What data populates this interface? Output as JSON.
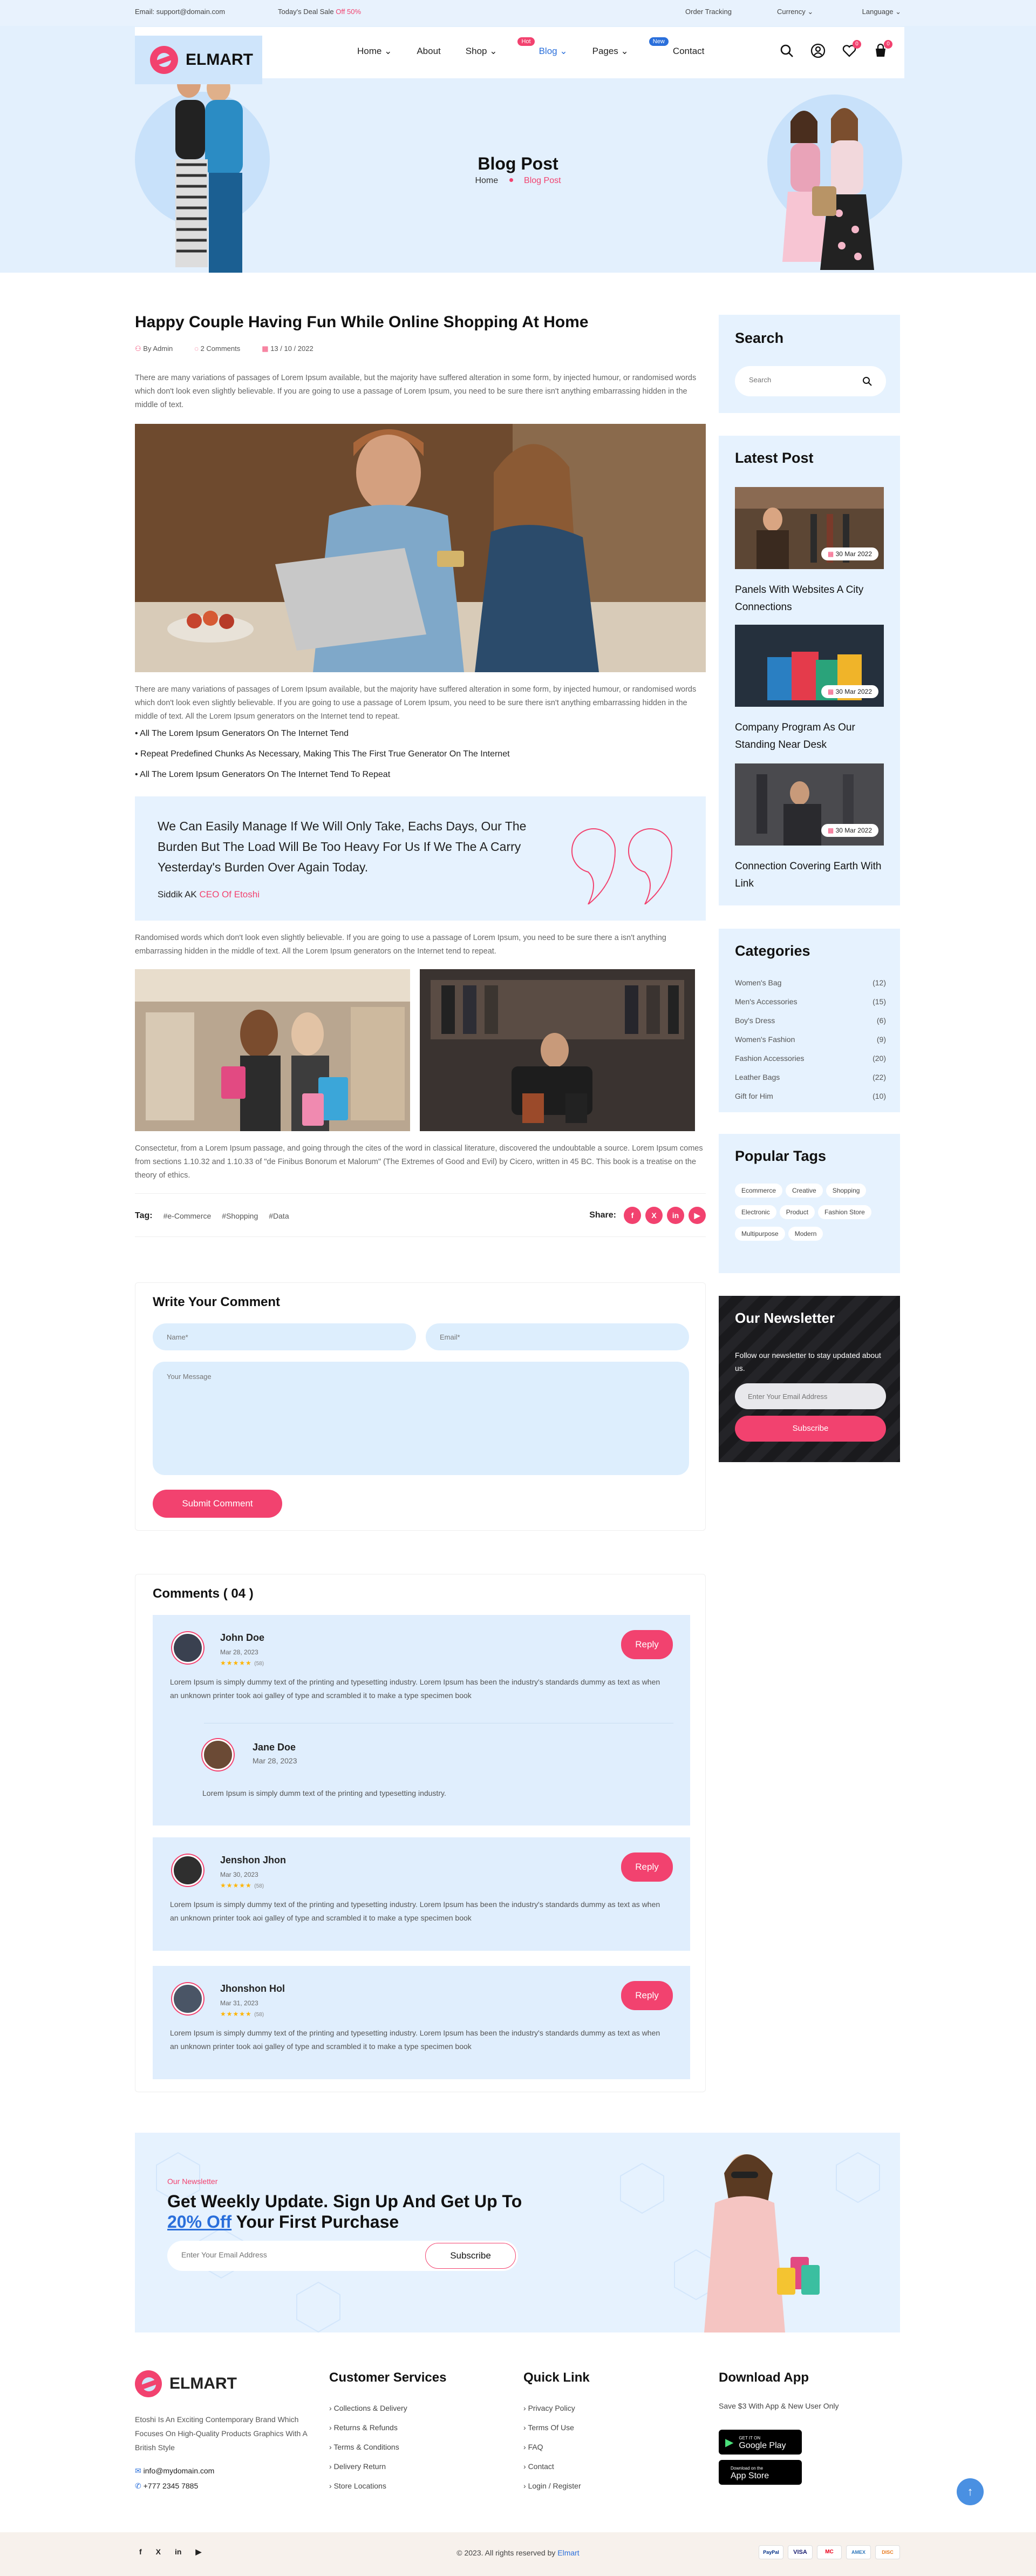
{
  "topbar": {
    "email": "Email: support@domain.com",
    "deal": "Today's Deal Sale",
    "deal_pct": "Off 50%",
    "order": "Order Tracking",
    "currency": "Currency",
    "language": "Language"
  },
  "header": {
    "logo": "ELMART",
    "nav": [
      "Home",
      "About",
      "Shop",
      "Blog",
      "Pages",
      "Contact"
    ],
    "badge_hot": "Hot",
    "badge_new": "New",
    "cart_count": "0",
    "wish_count": "0"
  },
  "hero": {
    "title": "Blog Post",
    "crumb_home": "Home",
    "crumb_current": "Blog Post"
  },
  "post": {
    "title": "Happy Couple Having Fun While Online Shopping At Home",
    "author": "By Admin",
    "comments": "2 Comments",
    "date": "13 / 10 / 2022",
    "p1": "There are many variations of passages of Lorem Ipsum available, but the majority have suffered alteration in some form, by injected humour, or randomised words which don't look even slightly believable. If you are going to use a passage of Lorem Ipsum, you need to be sure there isn't anything embarrassing hidden in the middle of text.",
    "p2": "There are many variations of passages of Lorem Ipsum available, but the majority have suffered alteration in some form, by injected humour, or randomised words which don't look even slightly believable. If you are going to use a passage of Lorem Ipsum, you need to be sure there isn't anything embarrassing hidden in the middle of text. All the Lorem Ipsum generators on the Internet tend to repeat.",
    "bullets": [
      "All The Lorem Ipsum Generators On The Internet Tend",
      "Repeat Predefined Chunks As Necessary, Making This The First True Generator On The Internet",
      "All The Lorem Ipsum Generators On The Internet Tend To Repeat"
    ],
    "quote": "We Can Easily Manage If We Will Only Take, Eachs Days, Our The Burden But The Load Will Be Too Heavy For Us If We The A Carry Yesterday's Burden Over Again Today.",
    "quote_author": "Siddik AK",
    "quote_role": "CEO Of Etoshi",
    "p3": "Randomised words which don't look even slightly believable. If you are going to use a passage of Lorem Ipsum, you need to be sure there a isn't anything embarrassing hidden in the middle of text. All the Lorem Ipsum generators on the Internet tend to repeat.",
    "p4": "Consectetur, from a Lorem Ipsum passage, and going through the cites of the word in classical literature, discovered the undoubtable a source. Lorem Ipsum comes from sections 1.10.32 and 1.10.33 of \"de Finibus Bonorum et Malorum\" (The Extremes of Good and Evil) by Cicero, written in 45 BC. This book is a treatise on the theory of ethics.",
    "tag_label": "Tag:",
    "tags": [
      "#e-Commerce",
      "#Shopping",
      "#Data"
    ],
    "share_label": "Share:"
  },
  "comment_form": {
    "title": "Write Your Comment",
    "name_ph": "Name*",
    "email_ph": "Email*",
    "message_ph": "Your Message",
    "submit": "Submit Comment"
  },
  "comments": {
    "title": "Comments ( 04 )",
    "reply": "Reply",
    "items": [
      {
        "name": "John Doe",
        "date": "Mar 28, 2023",
        "rating": "(58)",
        "text": "Lorem Ipsum is simply dummy text of the printing and typesetting industry. Lorem Ipsum has been the industry's standards dummy as text as when an unknown printer took aoi galley of type and scrambled it to make a type specimen book"
      },
      {
        "name": "Jane Doe",
        "date": "Mar 28, 2023",
        "text": "Lorem Ipsum is simply dumm text of the printing and typesetting industry."
      },
      {
        "name": "Jenshon Jhon",
        "date": "Mar 30, 2023",
        "rating": "(58)",
        "text": "Lorem Ipsum is simply dummy text of the printing and typesetting industry. Lorem Ipsum has been the industry's standards dummy as text as when an unknown printer took aoi galley of type and scrambled it to make a type specimen book"
      },
      {
        "name": "Jhonshon Hol",
        "date": "Mar 31, 2023",
        "rating": "(58)",
        "text": "Lorem Ipsum is simply dummy text of the printing and typesetting industry. Lorem Ipsum has been the industry's standards dummy as text as when an unknown printer took aoi galley of type and scrambled it to make a type specimen book"
      }
    ]
  },
  "sidebar": {
    "search_title": "Search",
    "search_ph": "Search",
    "latest_title": "Latest Post",
    "latest": [
      {
        "date": "30 Mar 2022",
        "title": "Panels With Websites A City Connections"
      },
      {
        "date": "30 Mar 2022",
        "title": "Company Program As Our Standing Near Desk"
      },
      {
        "date": "30 Mar 2022",
        "title": "Connection Covering Earth With Link"
      }
    ],
    "cat_title": "Categories",
    "cats": [
      {
        "n": "Women's Bag",
        "c": "(12)"
      },
      {
        "n": "Men's Accessories",
        "c": "(15)"
      },
      {
        "n": "Boy's Dress",
        "c": "(6)"
      },
      {
        "n": "Women's Fashion",
        "c": "(9)"
      },
      {
        "n": "Fashion Accessories",
        "c": "(20)"
      },
      {
        "n": "Leather Bags",
        "c": "(22)"
      },
      {
        "n": "Gift for Him",
        "c": "(10)"
      }
    ],
    "tags_title": "Popular Tags",
    "tags": [
      "Ecommerce",
      "Creative",
      "Shopping",
      "Electronic",
      "Product",
      "Fashion Store",
      "Multipurpose",
      "Modern"
    ],
    "news_title": "Our Newsletter",
    "news_sub": "Follow our newsletter to stay updated about us.",
    "news_ph": "Enter Your Email Address",
    "news_btn": "Subscribe"
  },
  "banner": {
    "eyebrow": "Our Newsletter",
    "title1": "Get Weekly Update. Sign Up And Get Up To",
    "title_pct": "20% Off",
    "title2": "Your First Purchase",
    "ph": "Enter Your Email Address",
    "btn": "Subscribe"
  },
  "footer": {
    "logo": "ELMART",
    "about": "Etoshi Is An Exciting Contemporary Brand Which Focuses On High-Quality Products Graphics With A British Style",
    "email": "info@mydomain.com",
    "phone": "+777 2345 7885",
    "cs_title": "Customer Services",
    "cs": [
      "Collections & Delivery",
      "Returns & Refunds",
      "Terms & Conditions",
      "Delivery Return",
      "Store Locations"
    ],
    "ql_title": "Quick Link",
    "ql": [
      "Privacy Policy",
      "Terms Of Use",
      "FAQ",
      "Contact",
      "Login / Register"
    ],
    "app_title": "Download App",
    "app_sub": "Save $3 With App & New User Only",
    "gp_small": "GET IT ON",
    "gp": "Google Play",
    "as_small": "Download on the",
    "as": "App Store",
    "copyright": "© 2023. All rights reserved by",
    "brand": "Elmart",
    "pay": [
      "PayPal",
      "VISA",
      "MC",
      "AMEX",
      "DISC"
    ]
  },
  "colors": {
    "accent": "#f2426f",
    "light_blue": "#e6f2fe",
    "link_blue": "#2a6fdb"
  }
}
